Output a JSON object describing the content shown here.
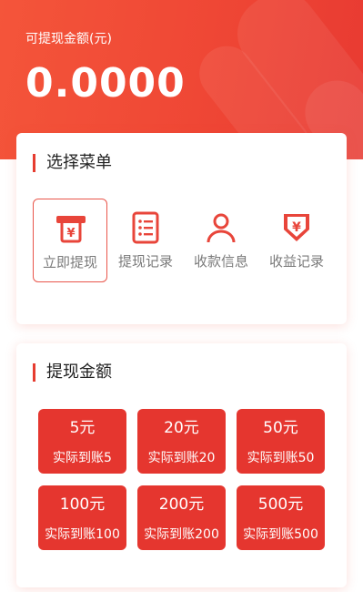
{
  "header": {
    "label": "可提现金额(元)",
    "amount": "0.0000"
  },
  "menu": {
    "title": "选择菜单",
    "items": [
      {
        "label": "立即提现",
        "icon": "atm-withdraw-icon"
      },
      {
        "label": "提现记录",
        "icon": "list-record-icon"
      },
      {
        "label": "收款信息",
        "icon": "user-profile-icon"
      },
      {
        "label": "收益记录",
        "icon": "yen-shield-icon"
      }
    ]
  },
  "amounts": {
    "title": "提现金额",
    "options": [
      {
        "value": "5元",
        "actual": "实际到账5"
      },
      {
        "value": "20元",
        "actual": "实际到账20"
      },
      {
        "value": "50元",
        "actual": "实际到账50"
      },
      {
        "value": "100元",
        "actual": "实际到账100"
      },
      {
        "value": "200元",
        "actual": "实际到账200"
      },
      {
        "value": "500元",
        "actual": "实际到账500"
      }
    ]
  },
  "colors": {
    "brand_red": "#e5362f",
    "hero_gradient_start": "#f4553a",
    "hero_gradient_end": "#e83a32",
    "muted_text": "#7a7a7a"
  }
}
